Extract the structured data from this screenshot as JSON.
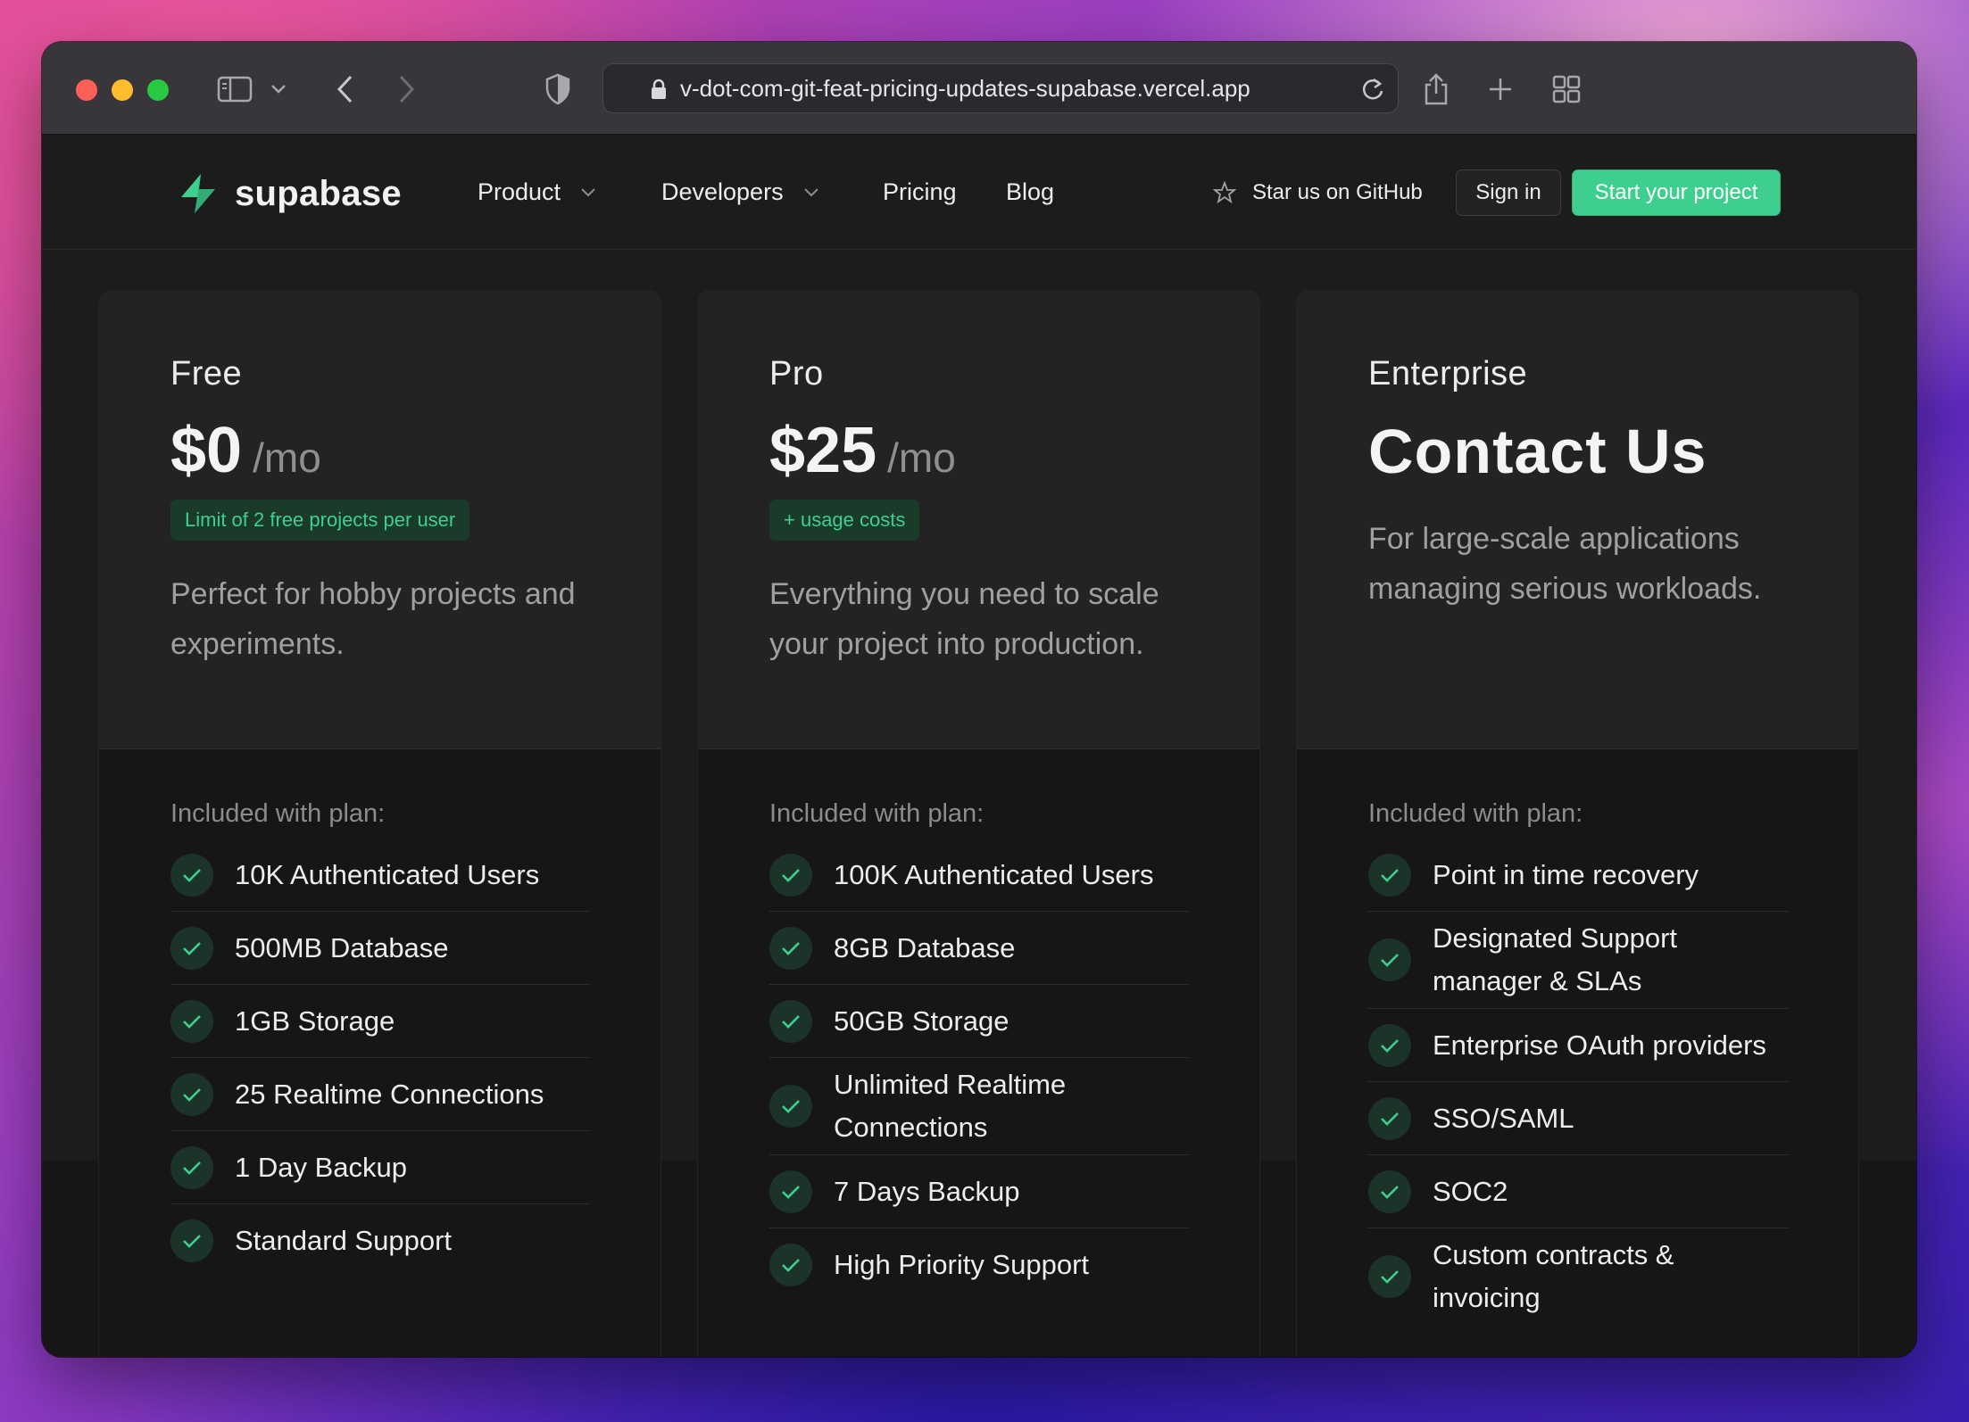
{
  "browser": {
    "url": "v-dot-com-git-feat-pricing-updates-supabase.vercel.app"
  },
  "site": {
    "brand": "supabase",
    "nav": {
      "product": "Product",
      "developers": "Developers",
      "pricing": "Pricing",
      "blog": "Blog",
      "github": "Star us on GitHub",
      "sign_in": "Sign in",
      "start": "Start your project"
    }
  },
  "colors": {
    "accent": "#3ecf8e",
    "background": "#1c1c1c",
    "card": "#232323"
  },
  "plans": [
    {
      "name": "Free",
      "price": "$0",
      "per": "/mo",
      "badge": "Limit of 2 free projects per user",
      "description": "Perfect for hobby projects and experiments.",
      "included_label": "Included with plan:",
      "features": [
        "10K Authenticated Users",
        "500MB Database",
        "1GB Storage",
        "25 Realtime Connections",
        "1 Day Backup",
        "Standard Support"
      ]
    },
    {
      "name": "Pro",
      "price": "$25",
      "per": "/mo",
      "badge": "+ usage costs",
      "description": "Everything you need to scale your project into production.",
      "included_label": "Included with plan:",
      "features": [
        "100K Authenticated Users",
        "8GB Database",
        "50GB Storage",
        "Unlimited Realtime Connections",
        "7 Days Backup",
        "High Priority Support"
      ]
    },
    {
      "name": "Enterprise",
      "headline": "Contact Us",
      "description": "For large-scale applications managing serious workloads.",
      "included_label": "Included with plan:",
      "features": [
        "Point in time recovery",
        "Designated Support manager & SLAs",
        "Enterprise OAuth providers",
        "SSO/SAML",
        "SOC2",
        "Custom contracts & invoicing"
      ]
    }
  ]
}
